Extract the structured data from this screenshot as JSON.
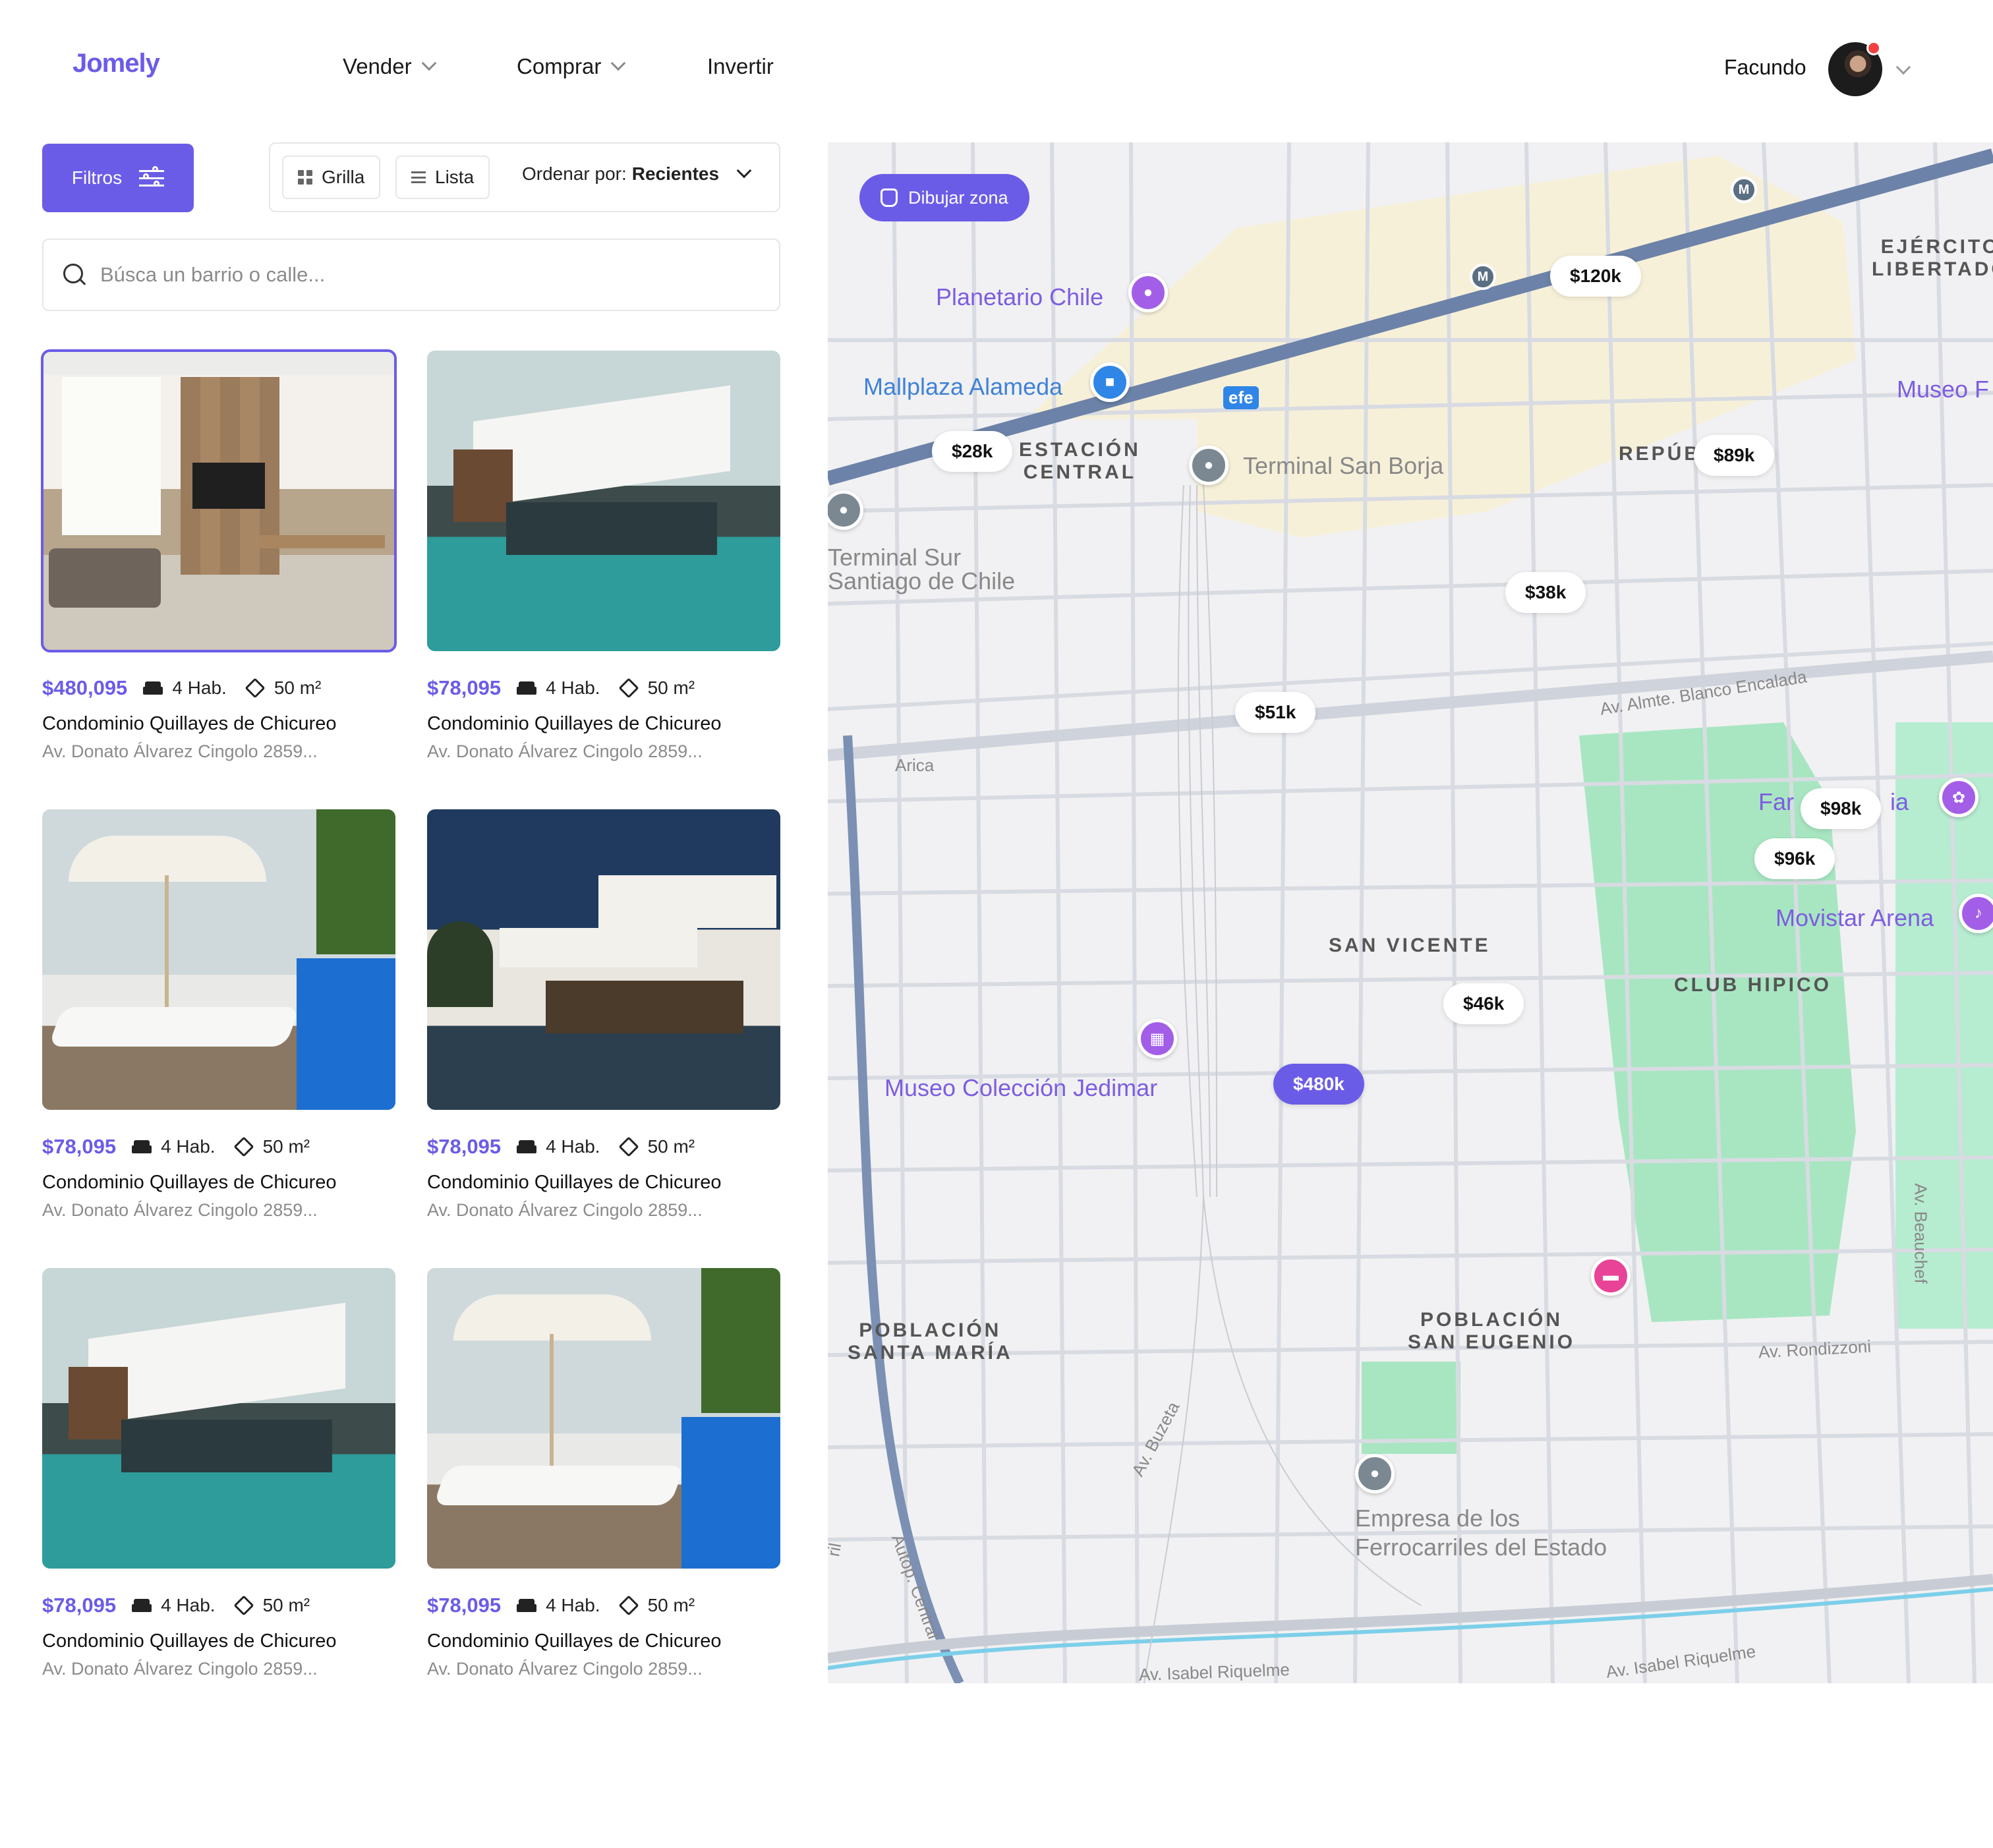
{
  "header": {
    "logo": "Jomely",
    "nav": [
      {
        "label": "Vender",
        "has_dropdown": true
      },
      {
        "label": "Comprar",
        "has_dropdown": true
      },
      {
        "label": "Invertir",
        "has_dropdown": false
      }
    ],
    "user_name": "Facundo"
  },
  "toolbar": {
    "filters_label": "Filtros",
    "grid_label": "Grilla",
    "list_label": "Lista",
    "sort_prefix": "Ordenar por:",
    "sort_value": "Recientes"
  },
  "search": {
    "placeholder": "Búsca un barrio o calle..."
  },
  "listings": [
    {
      "price": "$480,095",
      "rooms": "4 Hab.",
      "area": "50 m²",
      "title": "Condominio Quillayes de Chicureo",
      "address": "Av. Donato Álvarez Cingolo 2859...",
      "image": "interior",
      "selected": true
    },
    {
      "price": "$78,095",
      "rooms": "4 Hab.",
      "area": "50 m²",
      "title": "Condominio Quillayes de Chicureo",
      "address": "Av. Donato Álvarez Cingolo 2859...",
      "image": "villa-pool",
      "selected": false
    },
    {
      "price": "$78,095",
      "rooms": "4 Hab.",
      "area": "50 m²",
      "title": "Condominio Quillayes de Chicureo",
      "address": "Av. Donato Álvarez Cingolo 2859...",
      "image": "pool-deck",
      "selected": false
    },
    {
      "price": "$78,095",
      "rooms": "4 Hab.",
      "area": "50 m²",
      "title": "Condominio Quillayes de Chicureo",
      "address": "Av. Donato Álvarez Cingolo 2859...",
      "image": "dusk-house",
      "selected": false
    },
    {
      "price": "$78,095",
      "rooms": "4 Hab.",
      "area": "50 m²",
      "title": "Condominio Quillayes de Chicureo",
      "address": "Av. Donato Álvarez Cingolo 2859...",
      "image": "villa-pool",
      "selected": false
    },
    {
      "price": "$78,095",
      "rooms": "4 Hab.",
      "area": "50 m²",
      "title": "Condominio Quillayes de Chicureo",
      "address": "Av. Donato Álvarez Cingolo 2859...",
      "image": "pool-deck",
      "selected": false
    }
  ],
  "map": {
    "draw_zone_label": "Dibujar zona",
    "price_pins": [
      {
        "label": "$120k",
        "active": false
      },
      {
        "label": "$28k",
        "active": false
      },
      {
        "label": "$89k",
        "active": false
      },
      {
        "label": "$38k",
        "active": false
      },
      {
        "label": "$51k",
        "active": false
      },
      {
        "label": "$98k",
        "active": false
      },
      {
        "label": "$96k",
        "active": false
      },
      {
        "label": "$46k",
        "active": false
      },
      {
        "label": "$480k",
        "active": true
      }
    ],
    "places": {
      "planetario": "Planetario Chile",
      "mallplaza": "Mallplaza Alameda",
      "terminal_san_borja": "Terminal San Borja",
      "terminal_sur_1": "Terminal Sur",
      "terminal_sur_2": "Santiago de Chile",
      "museo_jedimar": "Museo Colección Jedimar",
      "movistar": "Movistar Arena",
      "empresa_1": "Empresa de los",
      "empresa_2": "Ferrocarriles del Estado",
      "museo_edge": "Museo F",
      "fan_edge": "Far",
      "fan_edge2": "ia",
      "efe": "efe"
    },
    "districts": {
      "estacion_1": "ESTACIÓN",
      "estacion_2": "CENTRAL",
      "ejercito_1": "EJÉRCITO",
      "ejercito_2": "LIBERTADO",
      "republica": "REPÚB",
      "san_vicente": "SAN VICENTE",
      "club_hipico": "CLUB HIPICO",
      "santa_maria_1": "POBLACIÓN",
      "santa_maria_2": "SANTA MARÍA",
      "san_eugenio_1": "POBLACIÓN",
      "san_eugenio_2": "SAN EUGENIO"
    },
    "streets": {
      "almte_blanco": "Av. Almte. Blanco Encalada",
      "arica": "Arica",
      "beauchef": "Av. Beauchef",
      "rondizzoni": "Av. Rondizzoni",
      "buzeta": "Av. Buzeta",
      "autop_central": "Autop. Central",
      "isabel_riquelme_1": "Av. Isabel Riquelme",
      "isabel_riquelme_2": "Av. Isabel Riquelme",
      "ril": "ril"
    },
    "metro_label": "M"
  }
}
